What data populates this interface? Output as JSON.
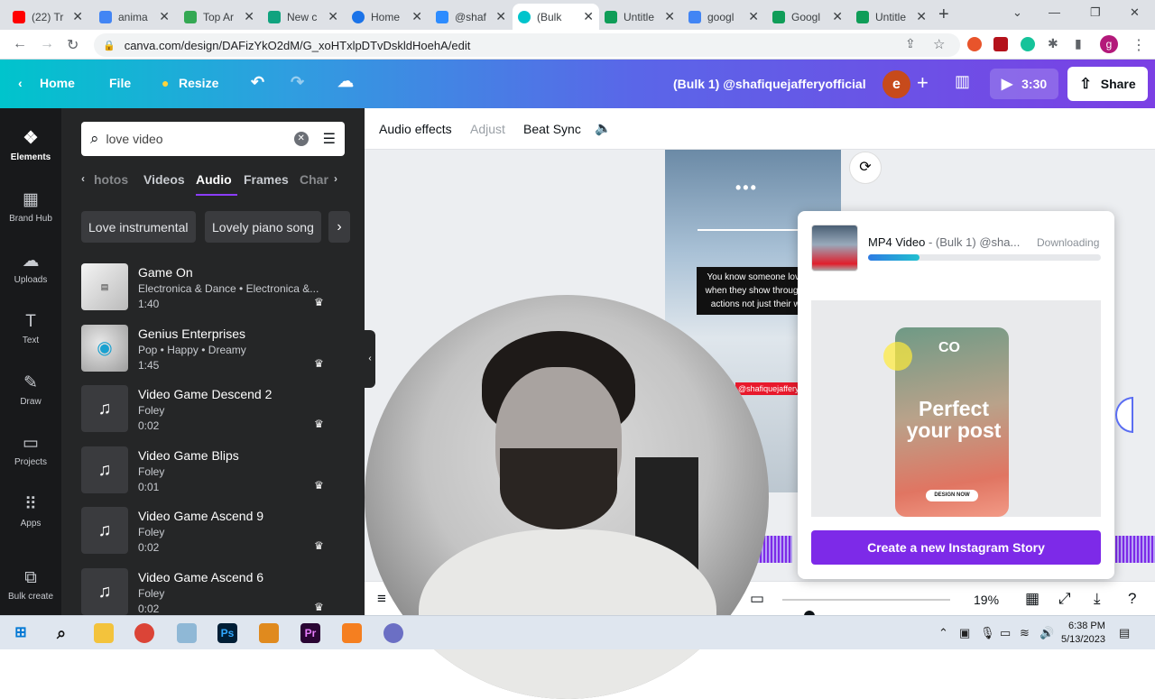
{
  "browser": {
    "tabs": [
      {
        "title": "(22) Tr",
        "color": "#ff0000"
      },
      {
        "title": "anima",
        "color": "#4285f4"
      },
      {
        "title": "Top Ar",
        "color": "#34a853"
      },
      {
        "title": "New c",
        "color": "#10a37f"
      },
      {
        "title": "Home",
        "color": "#1b73e8"
      },
      {
        "title": "@shaf",
        "color": "#2d8cff"
      },
      {
        "title": "(Bulk",
        "color": "#00c4cc"
      },
      {
        "title": "Untitle",
        "color": "#0f9d58"
      },
      {
        "title": "googl",
        "color": "#4285f4"
      },
      {
        "title": "Googl",
        "color": "#0f9d58"
      },
      {
        "title": "Untitle",
        "color": "#0f9d58"
      }
    ],
    "url": "canva.com/design/DAFizYkO2dM/G_xoHTxlpDTvDskldHoehA/edit"
  },
  "header": {
    "home": "Home",
    "file": "File",
    "resize": "Resize",
    "title": "(Bulk 1) @shafiquejafferyofficial",
    "avatar": "e",
    "play_time": "3:30",
    "share": "Share"
  },
  "rail": [
    {
      "label": "Elements",
      "icon": "elements-icon",
      "glyph": "❖"
    },
    {
      "label": "Brand Hub",
      "icon": "brand-hub-icon",
      "glyph": "▦"
    },
    {
      "label": "Uploads",
      "icon": "uploads-icon",
      "glyph": "☁"
    },
    {
      "label": "Text",
      "icon": "text-icon",
      "glyph": "T"
    },
    {
      "label": "Draw",
      "icon": "draw-icon",
      "glyph": "✎"
    },
    {
      "label": "Projects",
      "icon": "projects-icon",
      "glyph": "▭"
    },
    {
      "label": "Apps",
      "icon": "apps-icon",
      "glyph": "⠿"
    },
    {
      "label": "Bulk create",
      "icon": "bulk-create-icon",
      "glyph": "⧉"
    }
  ],
  "panel": {
    "search_value": "love video",
    "tabs": [
      "hotos",
      "Videos",
      "Audio",
      "Frames",
      "Char"
    ],
    "chips": [
      "Love instrumental",
      "Lovely piano song"
    ],
    "items": [
      {
        "title": "Game On",
        "meta": "Electronica & Dance • Electronica &...",
        "duration": "1:40"
      },
      {
        "title": "Genius Enterprises",
        "meta": "Pop • Happy • Dreamy",
        "duration": "1:45"
      },
      {
        "title": "Video Game Descend 2",
        "meta": "Foley",
        "duration": "0:02"
      },
      {
        "title": "Video Game Blips",
        "meta": "Foley",
        "duration": "0:01"
      },
      {
        "title": "Video Game Ascend 9",
        "meta": "Foley",
        "duration": "0:02"
      },
      {
        "title": "Video Game Ascend 6",
        "meta": "Foley",
        "duration": "0:02"
      }
    ]
  },
  "toolbar": {
    "audio_effects": "Audio effects",
    "adjust": "Adjust",
    "beat_sync": "Beat Sync"
  },
  "canvas": {
    "dots": "•••",
    "quote": "You know someone love you when they show through their actions not just their words",
    "handle": "@shafiquejafferyof"
  },
  "download": {
    "title": "MP4 Video",
    "subtitle": " - (Bulk 1) @sha...",
    "status": "Downloading",
    "progress": 0.22,
    "preview_logo": "CO",
    "preview_headline": "Perfect your post",
    "preview_button": "DESIGN NOW",
    "cta": "Create a new Instagram Story"
  },
  "footer": {
    "zoom": "19%",
    "zoom_fraction": 0.16
  },
  "taskbar": {
    "time": "6:38 PM",
    "date": "5/13/2023"
  }
}
